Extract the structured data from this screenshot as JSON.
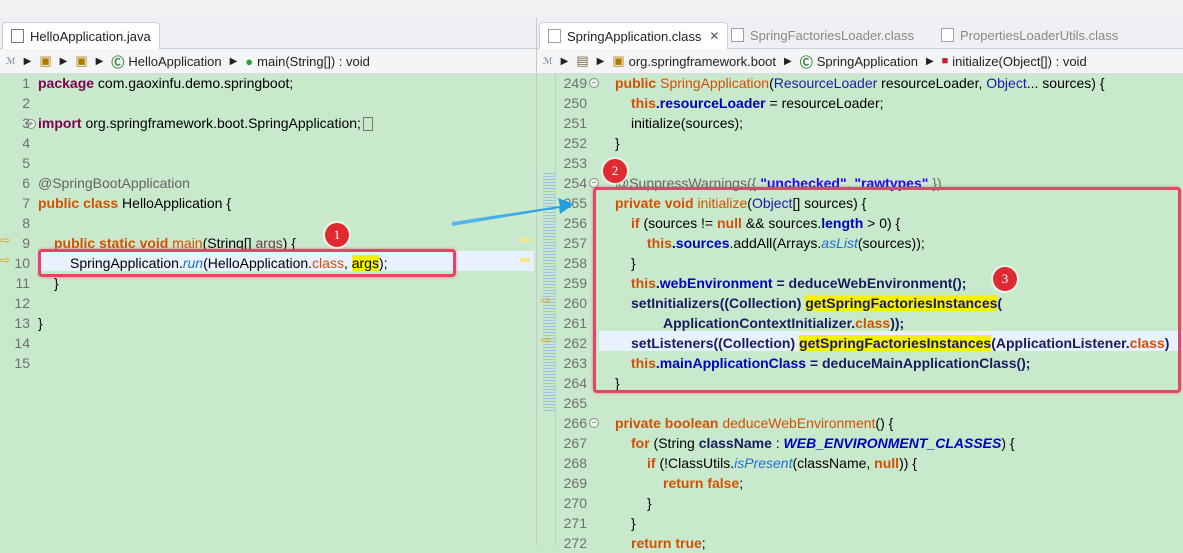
{
  "left": {
    "tab": {
      "label": "HelloApplication.java"
    },
    "breadcrumbs": [
      "HelloApplication",
      "main(String[]) : void"
    ],
    "lines": [
      {
        "n": "1"
      },
      {
        "n": "2"
      },
      {
        "n": "3"
      },
      {
        "n": "4"
      },
      {
        "n": "5"
      },
      {
        "n": "6"
      },
      {
        "n": "7"
      },
      {
        "n": "8"
      },
      {
        "n": "9"
      },
      {
        "n": "10"
      },
      {
        "n": "11"
      },
      {
        "n": "12"
      },
      {
        "n": "13"
      },
      {
        "n": "14"
      },
      {
        "n": "15"
      }
    ],
    "code": {
      "l1_kw": "package",
      "l1_rest": " com.gaoxinfu.demo.springboot;",
      "l3_kw": "import",
      "l3_rest": " org.springframework.boot.SpringApplication;",
      "l6": "@SpringBootApplication",
      "l7_kw": "public class",
      "l7_rest": " HelloApplication {",
      "l9_kw": "public static void",
      "l9_name": " main",
      "l9_rest": "(String[] ",
      "l9_arg": "args",
      "l9_end": ") {",
      "l10_a": "SpringApplication.",
      "l10_run": "run",
      "l10_b": "(HelloApplication.",
      "l10_cls": "class",
      "l10_c": ", ",
      "l10_args": "args",
      "l10_d": ");",
      "l11": "}",
      "l13": "}"
    }
  },
  "right": {
    "tabs": [
      {
        "label": "SpringApplication.class"
      },
      {
        "label": "SpringFactoriesLoader.class"
      },
      {
        "label": "PropertiesLoaderUtils.class"
      }
    ],
    "breadcrumbs": [
      "org.springframework.boot",
      "SpringApplication",
      "initialize(Object[]) : void"
    ],
    "lines": [
      {
        "n": "249"
      },
      {
        "n": "250"
      },
      {
        "n": "251"
      },
      {
        "n": "252"
      },
      {
        "n": "253"
      },
      {
        "n": "254"
      },
      {
        "n": "255"
      },
      {
        "n": "256"
      },
      {
        "n": "257"
      },
      {
        "n": "258"
      },
      {
        "n": "259"
      },
      {
        "n": "260"
      },
      {
        "n": "261"
      },
      {
        "n": "262"
      },
      {
        "n": "263"
      },
      {
        "n": "264"
      },
      {
        "n": "265"
      },
      {
        "n": "266"
      },
      {
        "n": "267"
      },
      {
        "n": "268"
      },
      {
        "n": "269"
      },
      {
        "n": "270"
      },
      {
        "n": "271"
      },
      {
        "n": "272"
      }
    ],
    "code": {
      "r249_kw": "public",
      "r249_name": " SpringApplication",
      "r249_a": "(",
      "r249_t": "ResourceLoader",
      "r249_b": " resourceLoader, ",
      "r249_t2": "Object",
      "r249_c": "... sources) {",
      "r250_kw": "this",
      "r250_f": ".resourceLoader",
      "r250_rest": " = resourceLoader;",
      "r251": "initialize(sources);",
      "r252": "}",
      "r254_a": "@SuppressWarnings({ ",
      "r254_s1": "\"unchecked\"",
      "r254_b": ", ",
      "r254_s2": "\"rawtypes\"",
      "r254_c": " })",
      "r255_kw": "private void",
      "r255_name": " initialize",
      "r255_a": "(",
      "r255_t": "Object",
      "r255_b": "[] sources) {",
      "r256_kw": "if",
      "r256_a": " (sources != ",
      "r256_null": "null",
      "r256_b": " && sources.",
      "r256_f": "length",
      "r256_c": " > 0) {",
      "r257_kw": "this",
      "r257_f": ".sources",
      "r257_a": ".addAll(Arrays.",
      "r257_m": "asList",
      "r257_b": "(sources));",
      "r258": "}",
      "r259_kw": "this",
      "r259_f": ".webEnvironment",
      "r259_a": " = deduceWebEnvironment();",
      "r260_a": "setInitializers((Collection) ",
      "r260_hl": "getSpringFactoriesInstances",
      "r260_b": "(",
      "r261_a": "ApplicationContextInitializer.",
      "r261_cls": "class",
      "r261_b": "));",
      "r262_a": "setListeners((Collection) ",
      "r262_hl": "getSpringFactoriesInstances",
      "r262_b": "(ApplicationListener.",
      "r262_cls": "class",
      "r262_c": ")",
      "r263_kw": "this",
      "r263_f": ".mainApplicationClass",
      "r263_a": " = deduceMainApplicationClass();",
      "r264": "}",
      "r266_kw": "private boolean",
      "r266_name": " deduceWebEnvironment",
      "r266_a": "() {",
      "r267_kw": "for",
      "r267_a": " (String ",
      "r267_v": "className",
      "r267_b": " : ",
      "r267_c": "WEB_ENVIRONMENT_CLASSES",
      "r267_d": ") {",
      "r268_kw": "if",
      "r268_a": " (!ClassUtils.",
      "r268_m": "isPresent",
      "r268_b": "(className, ",
      "r268_null": "null",
      "r268_c": ")) {",
      "r269_kw": "return false",
      "r269_a": ";",
      "r270": "}",
      "r271": "}",
      "r272_kw": "return true",
      "r272_a": ";"
    }
  },
  "badges": [
    "1",
    "2",
    "3"
  ],
  "colors": {
    "editor_bg": "#c9e9cd",
    "annotation_red": "#e64366",
    "arrow_blue": "#1e9be0",
    "badge_red": "#e02a32"
  }
}
